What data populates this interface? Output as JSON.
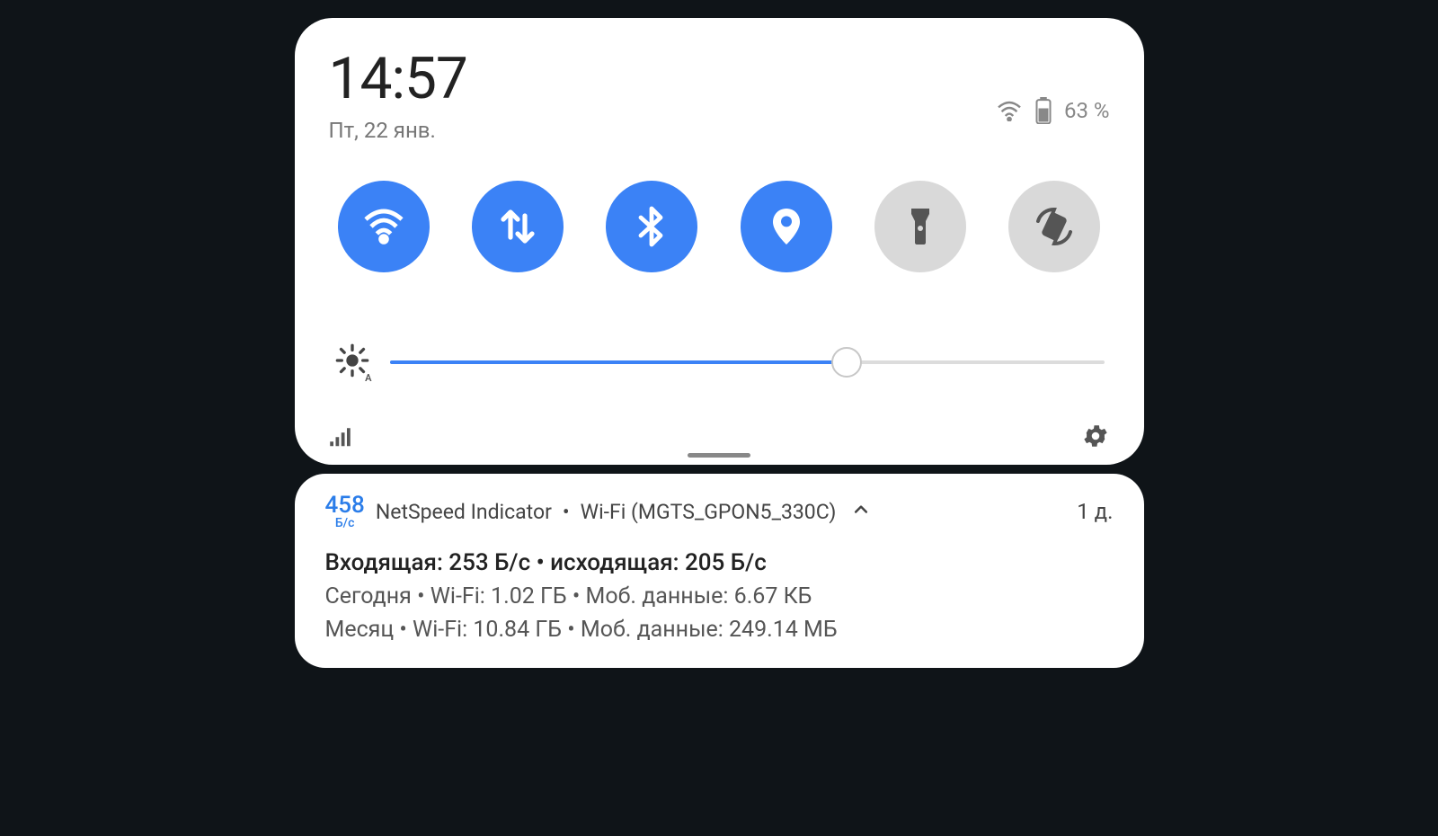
{
  "status": {
    "time": "14:57",
    "date": "Пт, 22 янв.",
    "battery_pct": "63 %"
  },
  "toggles": {
    "wifi": {
      "name": "wifi",
      "on": true
    },
    "data": {
      "name": "mobile-data",
      "on": true
    },
    "bluetooth": {
      "name": "bluetooth",
      "on": true
    },
    "location": {
      "name": "location",
      "on": true
    },
    "flashlight": {
      "name": "flashlight",
      "on": false
    },
    "rotate": {
      "name": "auto-rotate",
      "on": false
    }
  },
  "brightness": {
    "value_pct": 64,
    "auto_label": "A"
  },
  "notification": {
    "speed_value": "458",
    "speed_unit": "Б/с",
    "app_name": "NetSpeed Indicator",
    "dot": "•",
    "subtitle": "Wi-Fi (MGTS_GPON5_330C)",
    "age": "1 д.",
    "line1": "Входящая: 253 Б/с • исходящая: 205 Б/с",
    "line2": "Сегодня • Wi-Fi: 1.02 ГБ •  Моб. данные: 6.67 КБ",
    "line3": "Месяц • Wi-Fi: 10.84 ГБ •  Моб. данные: 249.14 МБ"
  }
}
